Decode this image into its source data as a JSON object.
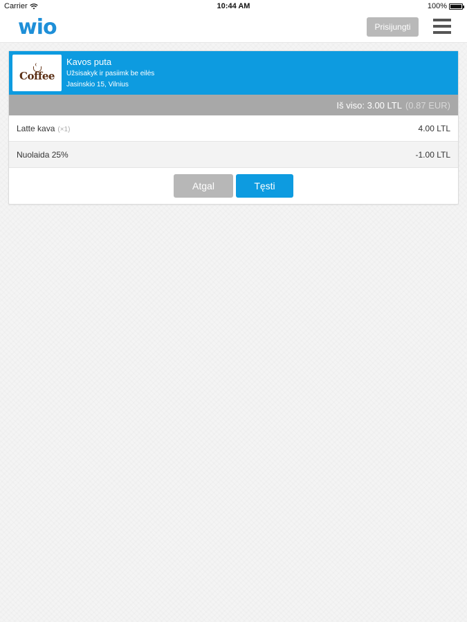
{
  "statusbar": {
    "carrier": "Carrier",
    "time": "10:44 AM",
    "battery": "100%"
  },
  "navbar": {
    "logo": "wio",
    "login_label": "Prisijungti"
  },
  "shop": {
    "logo_text": "Coffee",
    "name": "Kavos puta",
    "slogan": "Užsisakyk ir pasiimk be eilės",
    "address": "Jasinskio 15, Vilnius"
  },
  "totals": {
    "label": "Iš viso: 3.00 LTL",
    "eur": "(0.87 EUR)"
  },
  "items": [
    {
      "name": "Latte kava",
      "qty": "(×1)",
      "price": "4.00 LTL"
    },
    {
      "name": "Nuolaida 25%",
      "qty": "",
      "price": "-1.00 LTL"
    }
  ],
  "buttons": {
    "back": "Atgal",
    "next": "Tęsti"
  },
  "colors": {
    "accent": "#0d9be0",
    "logo": "#1e8fd8",
    "muted_button": "#b7b7b7",
    "total_bar": "#a8a8a8"
  }
}
